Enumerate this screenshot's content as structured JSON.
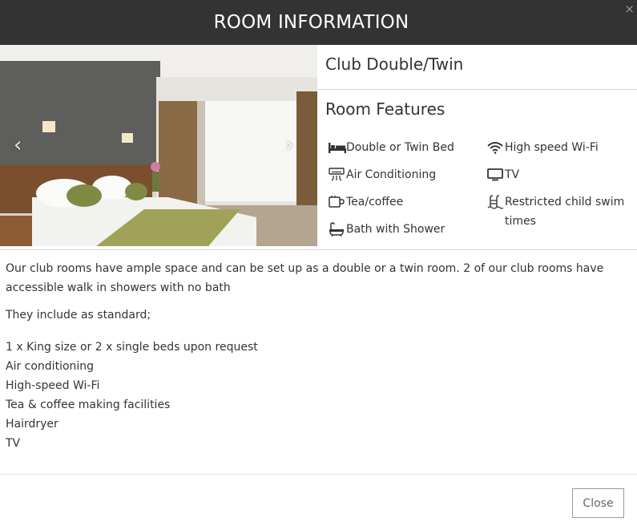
{
  "modal": {
    "title": "ROOM INFORMATION",
    "close_icon": "×",
    "close_button_label": "Close"
  },
  "carousel": {
    "prev_icon": "‹",
    "next_icon": "›"
  },
  "room": {
    "name": "Club Double/Twin",
    "features_title": "Room Features",
    "features": [
      {
        "icon": "bed-icon",
        "label": "Double or Twin Bed"
      },
      {
        "icon": "wifi-icon",
        "label": "High speed Wi-Fi"
      },
      {
        "icon": "air-conditioning-icon",
        "label": "Air Conditioning"
      },
      {
        "icon": "tv-icon",
        "label": "TV"
      },
      {
        "icon": "tea-coffee-icon",
        "label": "Tea/coffee"
      },
      {
        "icon": "pool-icon",
        "label": "Restricted child swim times"
      },
      {
        "icon": "bath-icon",
        "label": "Bath with Shower"
      }
    ],
    "description": "Our club rooms have ample space and can be set up as a double or a twin room. 2 of our club rooms have accessible walk in showers with no bath",
    "standard_intro": "They include as standard;",
    "standard_items": [
      "1 x King size or 2 x single beds upon request",
      "Air conditioning",
      "High-speed Wi-Fi",
      "Tea & coffee making facilities",
      "Hairdryer",
      "TV"
    ]
  },
  "colors": {
    "header_bg": "#333333",
    "header_text": "#ffffff",
    "text": "#333333",
    "divider": "#d8d8d8"
  }
}
